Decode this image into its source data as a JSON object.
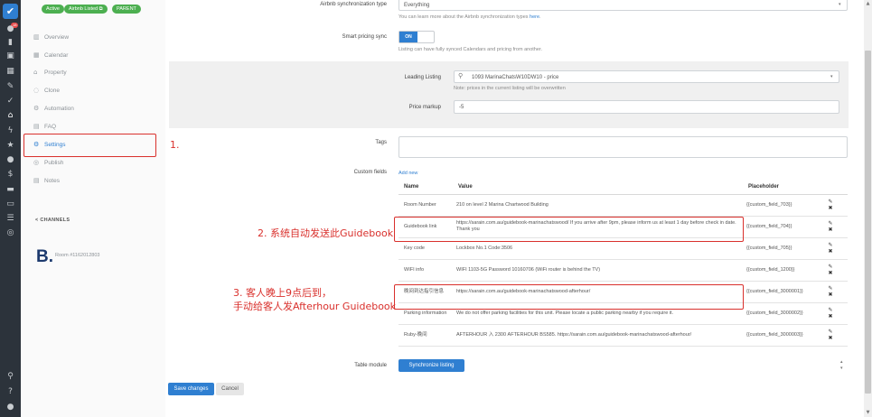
{
  "rail": {
    "badge": "18",
    "icons": [
      "logo-check-icon",
      "chat-icon",
      "bar-chart-icon",
      "calendar-icon",
      "tags-icon",
      "brush-icon",
      "check-icon",
      "home-icon",
      "bolt-icon",
      "star-icon",
      "users-icon",
      "dollar-icon",
      "briefcase-icon",
      "list-icon",
      "globe-icon",
      "search-icon",
      "help-icon",
      "user-icon"
    ]
  },
  "sidebar": {
    "tags": [
      "Active",
      "Airbnb Listed",
      "PARENT"
    ],
    "nav": [
      {
        "label": "Overview",
        "icon": "chart-icon"
      },
      {
        "label": "Calendar",
        "icon": "calendar-icon"
      },
      {
        "label": "Property",
        "icon": "home-icon"
      },
      {
        "label": "Clone",
        "icon": "clone-icon"
      },
      {
        "label": "Automation",
        "icon": "automation-icon"
      },
      {
        "label": "FAQ",
        "icon": "faq-icon"
      },
      {
        "label": "Settings",
        "icon": "gear-icon"
      },
      {
        "label": "Publish",
        "icon": "publish-icon"
      },
      {
        "label": "Notes",
        "icon": "notes-icon"
      }
    ],
    "channels_title": "CHANNELS",
    "channel_logo": "B.",
    "channel_room": "Room #1162012803"
  },
  "annotations": {
    "a1": "1.",
    "a2": "2. 系统自动发送此Guidebook",
    "a3_line1": "3. 客人晚上9点后到，",
    "a3_line2": "手动给客人发Afterhour Guidebook"
  },
  "form": {
    "sync_type_label": "Airbnb synchronization type",
    "sync_type_value": "Everything",
    "sync_type_help": "You can learn more about the Airbnb synchronization types",
    "sync_type_help_link": "here",
    "smart_pricing_label": "Smart pricing sync",
    "smart_pricing_state": "ON",
    "smart_pricing_help": "Listing can have fully synced Calendars and pricing from another.",
    "leading_label": "Leading Listing",
    "leading_value": "1093 MarinaChatsW10DW10 - price",
    "leading_help": "Note: prices in the current listing will be overwritten",
    "price_markup_label": "Price markup",
    "price_markup_value": "-5",
    "tags_label": "Tags",
    "custom_fields_label": "Custom fields",
    "add_new": "Add new",
    "table_module_label": "Table module",
    "synchronize_button": "Synchronize listing",
    "save_button": "Save changes",
    "cancel_button": "Cancel"
  },
  "custom_fields": {
    "headers": [
      "Name",
      "Value",
      "Placeholder",
      ""
    ],
    "rows": [
      {
        "name": "Room Number",
        "value": "210 on level 2 Marina Chartwood Building",
        "placeholder": "{{custom_field_703}}"
      },
      {
        "name": "Guidebook link",
        "value": "https://sarain.com.au/guidebook-marinachatswood/ If you arrive after 9pm, please inform us at least 1 day before check in date. Thank you",
        "placeholder": "{{custom_field_704}}"
      },
      {
        "name": "Key code",
        "value": "Lockbox No.1 Code:3506",
        "placeholder": "{{custom_field_705}}"
      },
      {
        "name": "WIFI info",
        "value": "WIFI 1103-5G Password 10160706 (WiFi router is behind the TV)",
        "placeholder": "{{custom_field_1200}}"
      },
      {
        "name": "晚间到达指引信息",
        "value": "https://sarain.com.au/guidebook-marinachatswood-afterhour/",
        "placeholder": "{{custom_field_3000001}}"
      },
      {
        "name": "Parking information",
        "value": "We do not offer parking facilities for this unit. Please locate a public parking nearby if you require it.",
        "placeholder": "{{custom_field_3000002}}"
      },
      {
        "name": "Ruby-晚间",
        "value": "AFTERHOUR  入 2300  AFTERHOUR  BS585.  https://sarain.com.au/guidebook-marinachatswood-afterhour/",
        "placeholder": "{{custom_field_3000003}}"
      }
    ]
  },
  "colors": {
    "accent": "#2f7fd1",
    "annotation": "#d9302c",
    "tag": "#4caf50",
    "rail": "#2c333b"
  }
}
